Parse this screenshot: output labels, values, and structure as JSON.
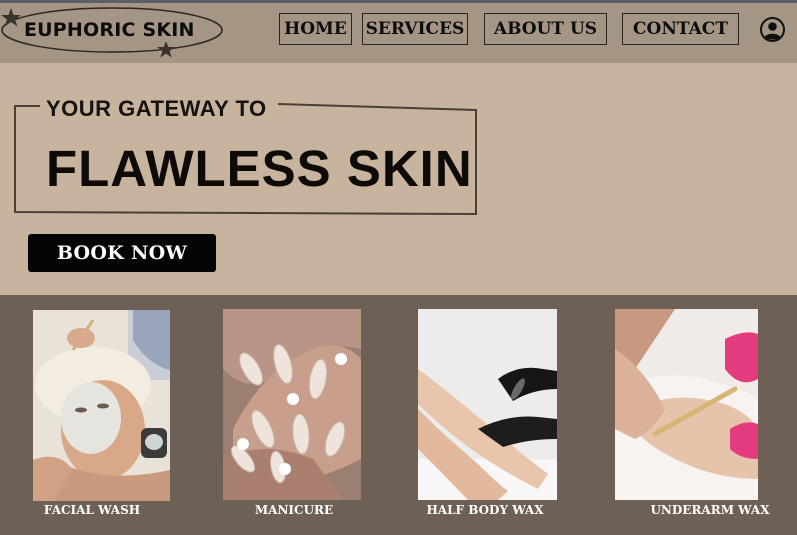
{
  "brand": {
    "name": "EUPHORIC SKIN"
  },
  "nav": {
    "items": [
      {
        "label": "HOME"
      },
      {
        "label": "SERVICES"
      },
      {
        "label": "ABOUT US"
      },
      {
        "label": "CONTACT"
      }
    ],
    "account_icon": "user-circle-icon"
  },
  "hero": {
    "subtitle": "YOUR GATEWAY TO",
    "title": "FLAWLESS SKIN",
    "cta_label": "BOOK NOW"
  },
  "services": [
    {
      "label": "FACIAL WASH",
      "image": "facial-treatment-photo"
    },
    {
      "label": "MANICURE",
      "image": "manicure-nails-photo"
    },
    {
      "label": "HALF BODY WAX",
      "image": "leg-waxing-photo"
    },
    {
      "label": "UNDERARM WAX",
      "image": "underarm-waxing-photo"
    }
  ],
  "colors": {
    "nav_bg": "#a59585",
    "hero_bg": "#c8b39e",
    "services_bg": "#6f6055",
    "button_bg": "#050505"
  }
}
